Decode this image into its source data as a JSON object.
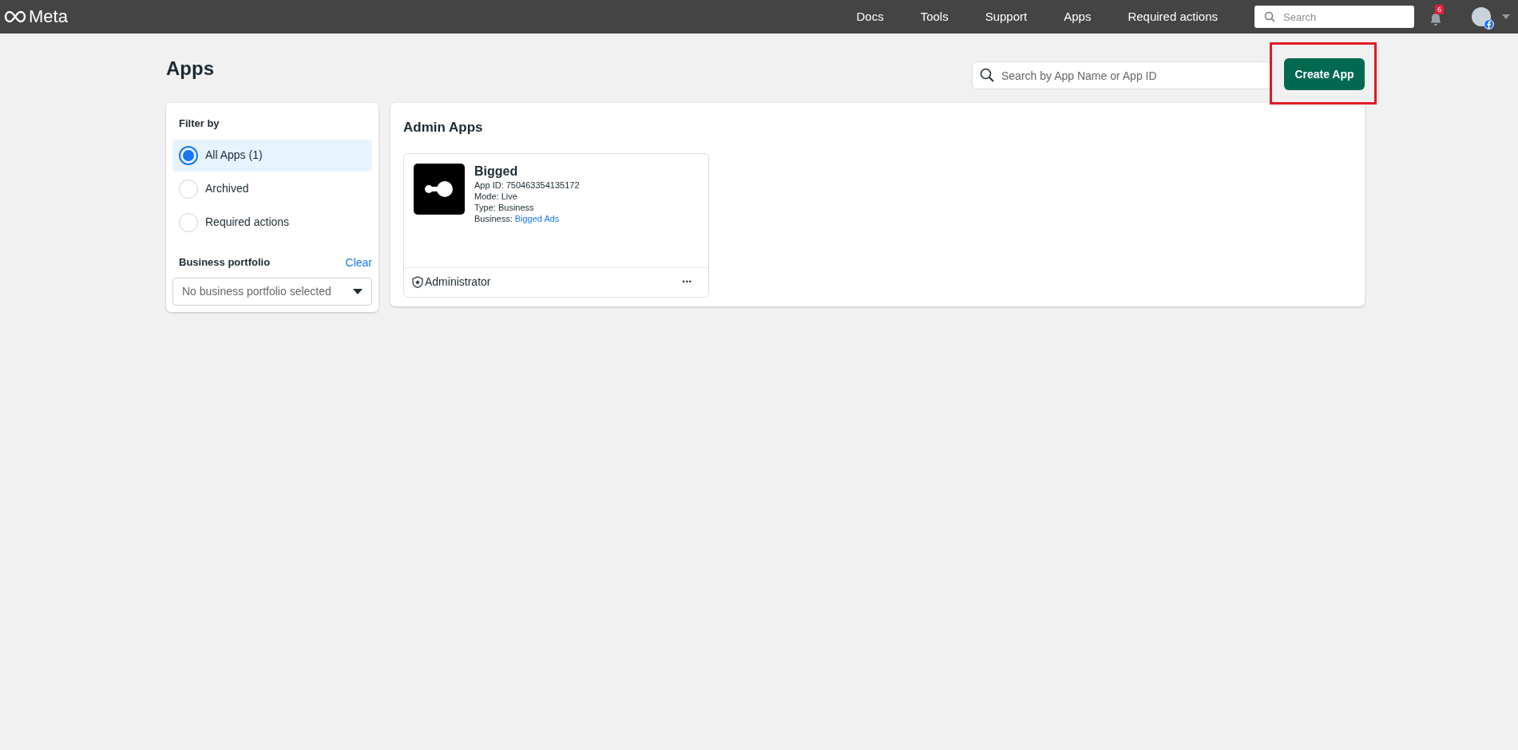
{
  "top_bar": {
    "logo": "Meta",
    "nav": [
      "Docs",
      "Tools",
      "Support",
      "Apps",
      "Required actions"
    ],
    "search": {
      "placeholder": "Search"
    },
    "notifications": "6"
  },
  "page": {
    "title": "Apps",
    "search": {
      "placeholder": "Search by App Name or App ID"
    },
    "create_button": {
      "label": "Create App",
      "highlighted": true
    }
  },
  "filter": {
    "title": "Filter by",
    "options": [
      {
        "label": "All Apps (1)",
        "selected": true
      },
      {
        "label": "Archived",
        "selected": false
      },
      {
        "label": "Required actions",
        "selected": false
      }
    ],
    "portfolio": {
      "label": "Business portfolio",
      "clear": "Clear",
      "value": "No business portfolio selected"
    }
  },
  "admin_apps": {
    "title": "Admin Apps",
    "apps": [
      {
        "name": "Bigged",
        "app_id": "App ID: 750463354135172",
        "mode": "Mode: Live",
        "type": "Type: Business",
        "business_label": "Business:",
        "business": "Bigged Ads",
        "role": "Administrator",
        "menu": "•••"
      }
    ]
  }
}
